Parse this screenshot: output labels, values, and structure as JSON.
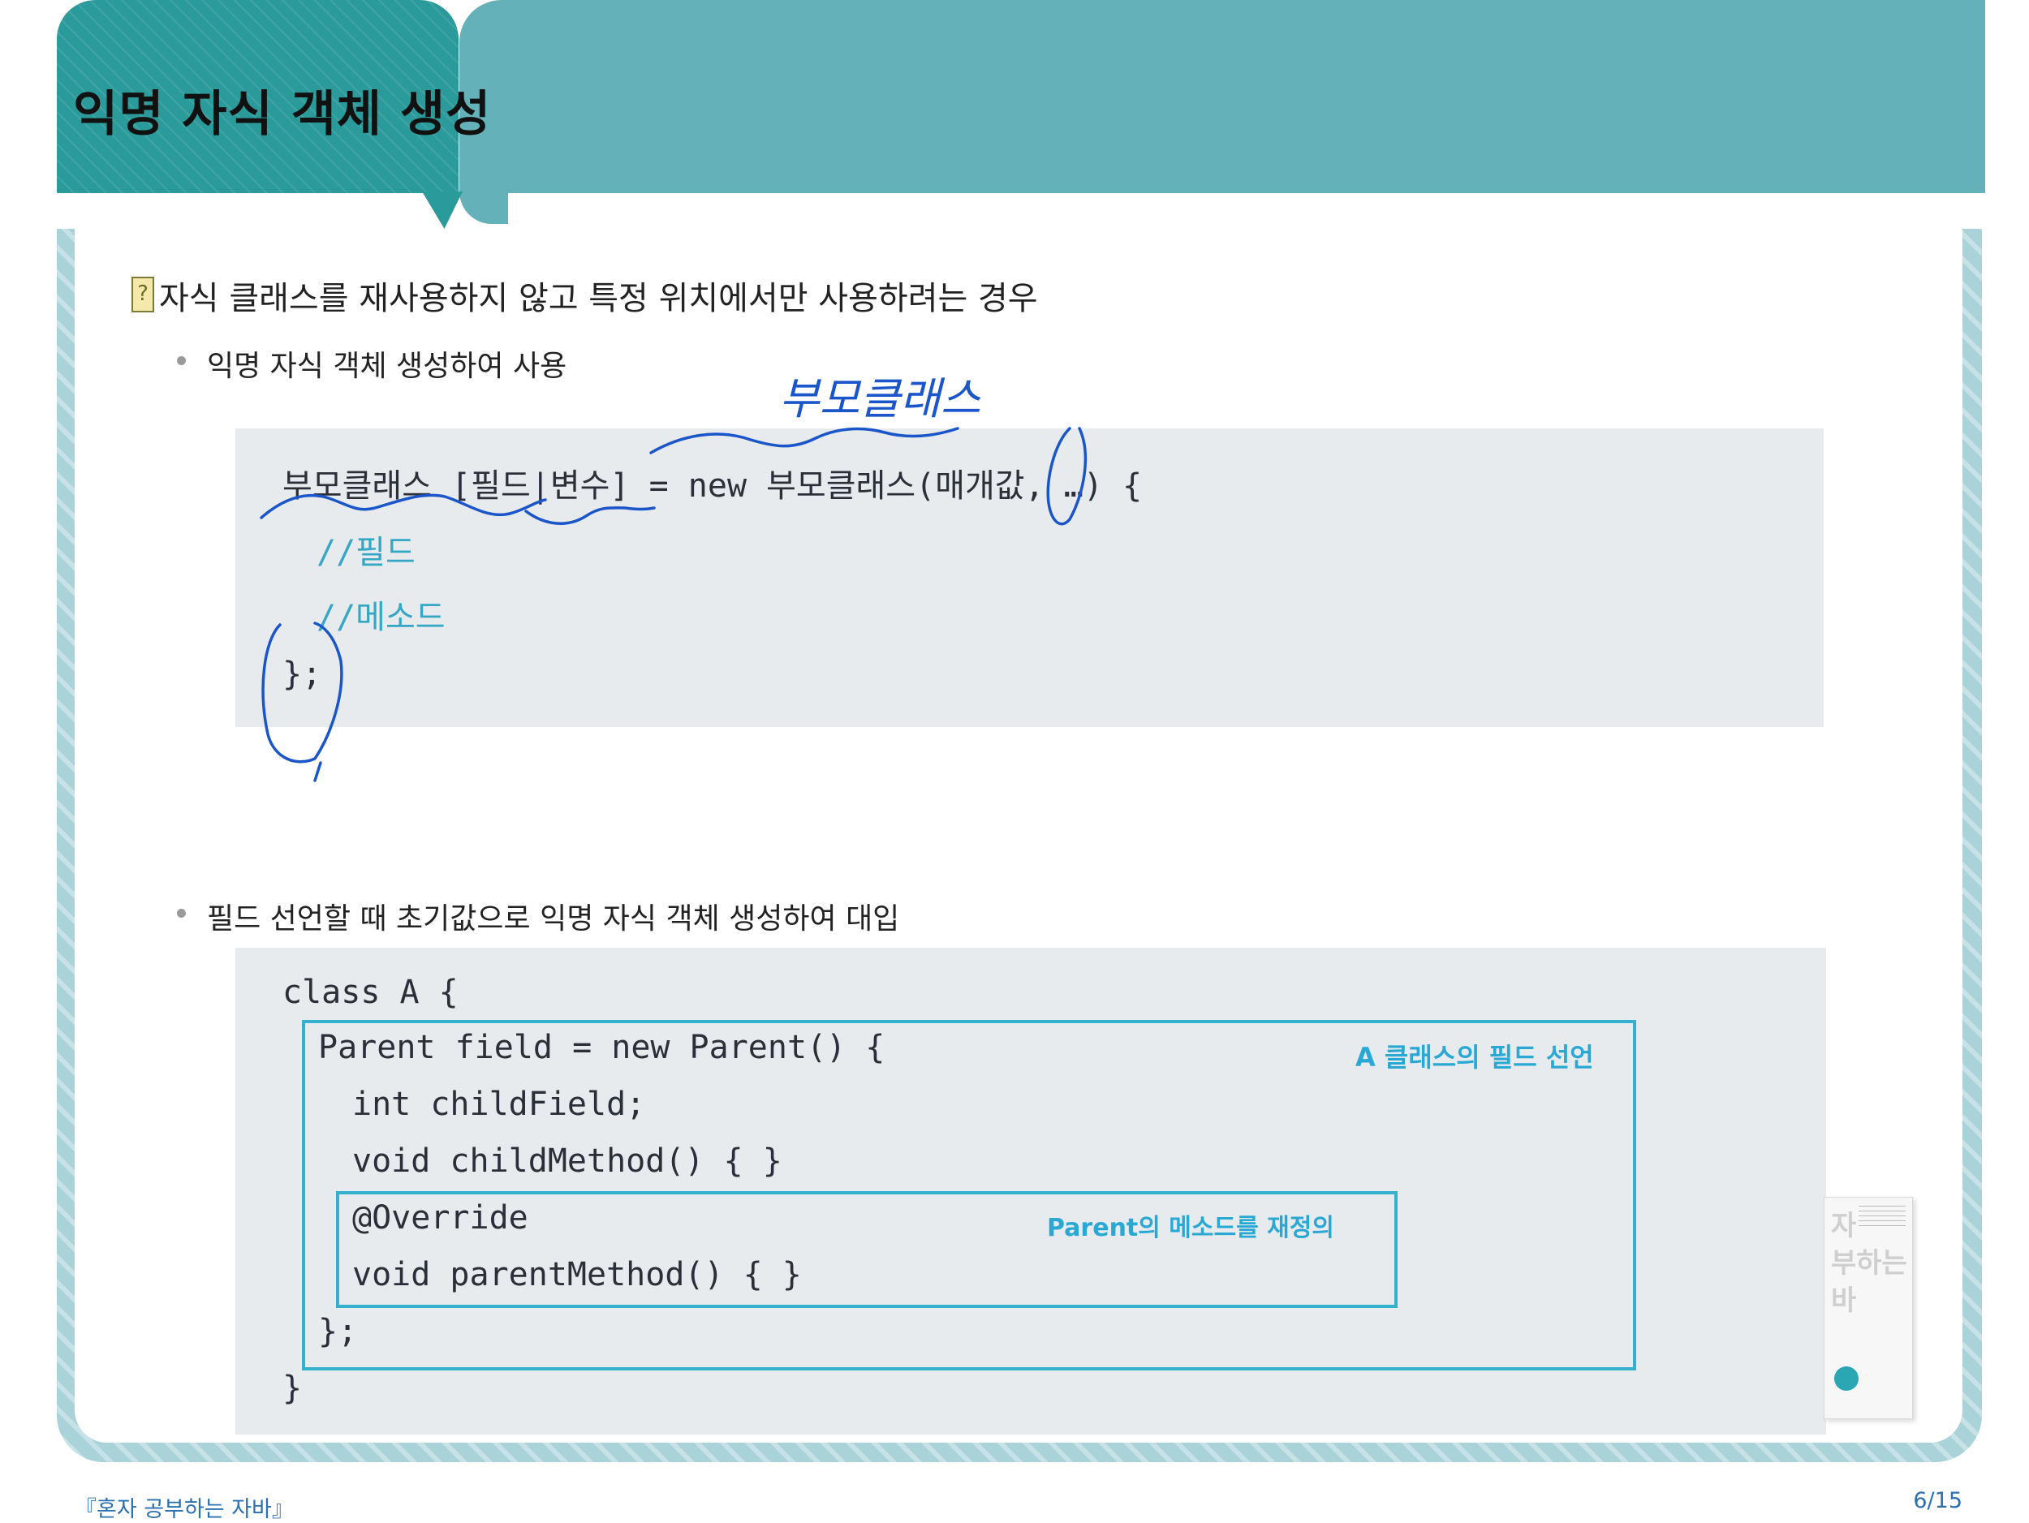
{
  "title": "익명 자식 객체 생성",
  "main_bullet": "자식 클래스를 재사용하지 않고 특정 위치에서만 사용하려는 경우",
  "question_icon": "?",
  "sub_bullets": [
    "익명 자식 객체 생성하여 사용",
    "필드 선언할 때 초기값으로 익명 자식 객체 생성하여 대입"
  ],
  "code1": {
    "line1": "부모클래스 [필드|변수] = new 부모클래스(매개값, …) {",
    "comment1": "//필드",
    "comment2": "//메소드",
    "line_end": "};"
  },
  "handwritten_note": "부모클래스",
  "code2": {
    "lines": [
      "class A {",
      "Parent field = new Parent() {",
      "int childField;",
      "void childMethod() { }",
      "@Override",
      "void parentMethod() { }",
      "};",
      "}"
    ],
    "annotation_outer": "A 클래스의 필드 선언",
    "annotation_inner": "Parent의 메소드를 재정의"
  },
  "book_cover": {
    "title_lines": [
      "자",
      "부하는",
      "바"
    ]
  },
  "footer": {
    "left": "『혼자 공부하는 자바』",
    "page": "6/15"
  },
  "colors": {
    "header_dark": "#2b9a9b",
    "header_light": "#64b1ba",
    "frame": "#a9d3d8",
    "code_bg": "#e8ebee",
    "annotation": "#2aa8d4",
    "ink": "#1a56c9"
  }
}
